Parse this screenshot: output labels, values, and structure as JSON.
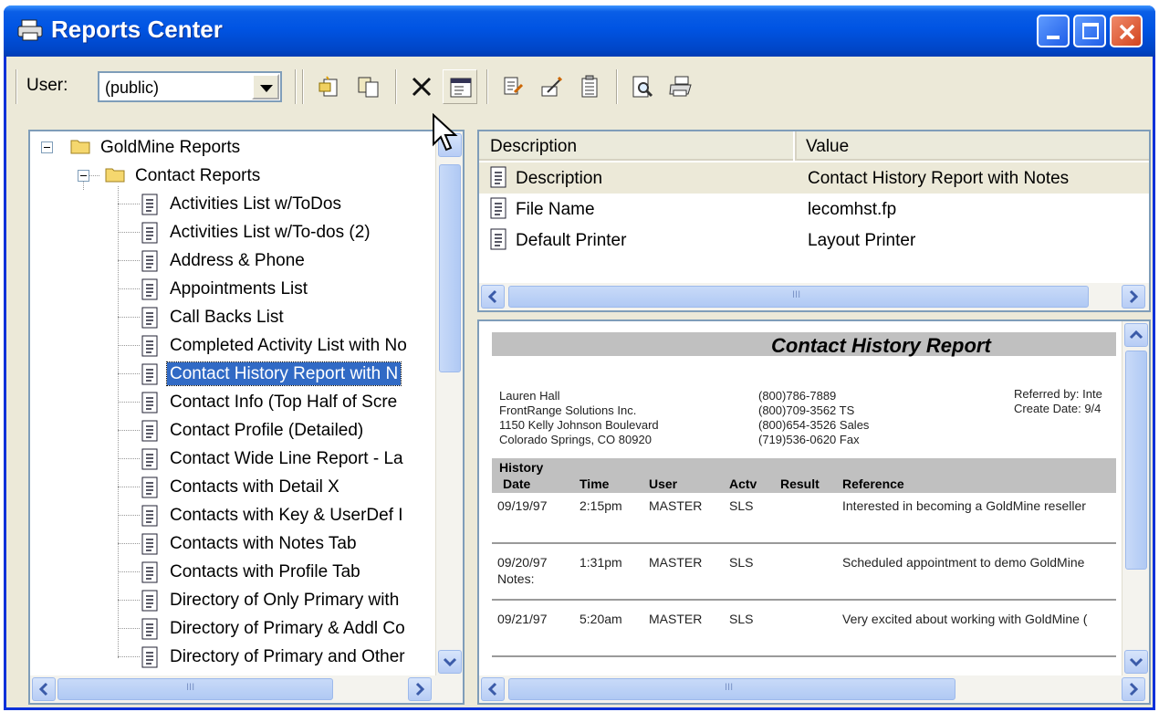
{
  "window": {
    "title": "Reports Center"
  },
  "toolbar": {
    "user_label": "User:",
    "user_value": "(public)"
  },
  "tree": {
    "root": "GoldMine Reports",
    "group": "Contact Reports",
    "items": [
      "Activities List w/ToDos",
      "Activities List w/To-dos (2)",
      "Address & Phone",
      "Appointments List",
      "Call Backs List",
      "Completed Activity List with No",
      "Contact History Report with N",
      "Contact Info (Top Half of Scre",
      "Contact Profile (Detailed)",
      "Contact Wide Line Report - La",
      "Contacts with Detail X",
      "Contacts with Key & UserDef I",
      "Contacts with Notes Tab",
      "Contacts with Profile Tab",
      "Directory of Only Primary with",
      "Directory of Primary & Addl Co",
      "Directory of Primary and Other"
    ],
    "selected_index": 6,
    "scroll_marker": "III"
  },
  "properties": {
    "headers": [
      "Description",
      "Value"
    ],
    "rows": [
      {
        "name": "Description",
        "value": "Contact History Report with Notes"
      },
      {
        "name": "File Name",
        "value": "lecomhst.fp"
      },
      {
        "name": "Default Printer",
        "value": "Layout Printer"
      }
    ],
    "scroll_marker": "III"
  },
  "preview": {
    "title": "Contact History Report",
    "contact_lines": [
      "Lauren Hall",
      "FrontRange Solutions Inc.",
      "1150 Kelly Johnson Boulevard",
      "Colorado Springs, CO 80920"
    ],
    "phone_lines": [
      "(800)786-7889",
      "(800)709-3562  TS",
      "(800)654-3526  Sales",
      "(719)536-0620  Fax"
    ],
    "referred_by": "Referred by:  Inte",
    "create_date": "Create Date:  9/4",
    "history_label": "History",
    "columns": [
      "Date",
      "Time",
      "User",
      "Actv",
      "Result",
      "Reference"
    ],
    "entries": [
      {
        "date": "09/19/97",
        "time": "2:15pm",
        "user": "MASTER",
        "actv": "SLS",
        "result": "",
        "reference": "Interested in becoming a GoldMine reseller"
      },
      {
        "date": "09/20/97",
        "time": "1:31pm",
        "user": "MASTER",
        "actv": "SLS",
        "result": "",
        "reference": "Scheduled appointment to demo GoldMine",
        "notes": "Notes:"
      },
      {
        "date": "09/21/97",
        "time": "5:20am",
        "user": "MASTER",
        "actv": "SLS",
        "result": "",
        "reference": "Very excited about working with GoldMine ("
      }
    ],
    "scroll_marker": "III"
  }
}
